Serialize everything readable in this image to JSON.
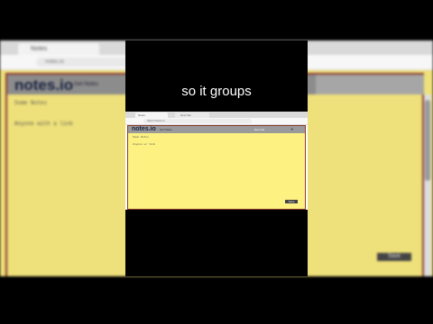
{
  "caption": "so it groups",
  "background": {
    "tab_title": "Notes",
    "url": "notes.io",
    "logo": "notes.io",
    "subtitle": "Get Notes",
    "left_line1": "Some Notes",
    "left_line2": "Anyone with a link",
    "save_label": "Save"
  },
  "screenshot": {
    "tab_title": "Notes",
    "tab2_title": "New Tab",
    "url": "https://notes.io",
    "logo": "notes.io",
    "subtitle": "Get Notes",
    "controls_label": "Get Link",
    "close_glyph": "✕",
    "note_line1": "Some Notes",
    "note_line2": "Anyone w/ link",
    "save_label": "Save"
  },
  "colors": {
    "page_background": "#000000",
    "note_yellow": "#fdf281",
    "header_gray": "#9a9a9a",
    "border_red": "#8b3a2e",
    "logo_navy": "#1a2340"
  }
}
